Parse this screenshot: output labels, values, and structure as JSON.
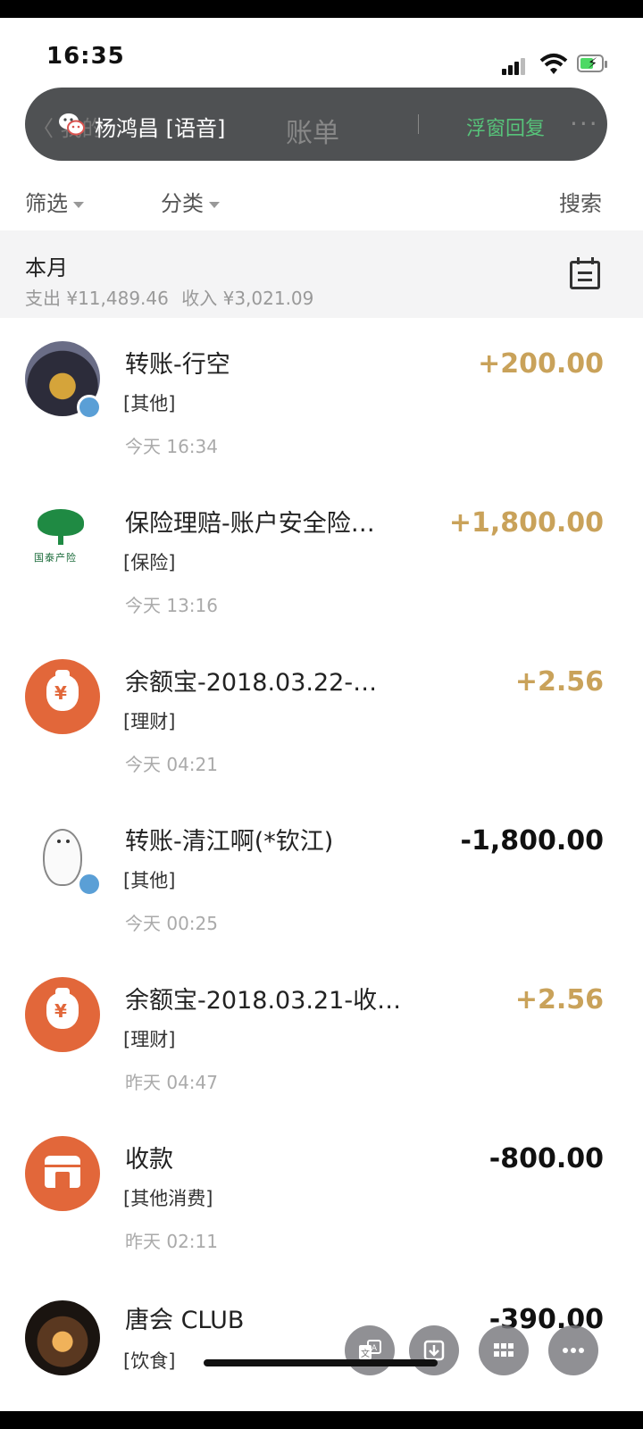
{
  "status_bar": {
    "time": "16:35",
    "icons": [
      "signal-icon",
      "wifi-icon",
      "battery-charging-icon"
    ]
  },
  "voice_call_pill": {
    "caller": "杨鸿昌 [语音]",
    "reply_label": "浮窗回复",
    "behind_title": "账单",
    "behind_back": "〈 我的",
    "behind_more": "···"
  },
  "filter_bar": {
    "filter_label": "筛选",
    "category_label": "分类",
    "search_label": "搜索"
  },
  "month": {
    "label": "本月",
    "expense_text": "支出 ¥11,489.46",
    "income_text": "收入 ¥3,021.09"
  },
  "bills": [
    {
      "title": "转账-行空",
      "category": "[其他]",
      "date": "今天 16:34",
      "amount": "+200.00",
      "type": "income",
      "avatar": "player-photo"
    },
    {
      "title": "保险理赔-账户安全险…",
      "category": "[保险]",
      "date": "今天 13:16",
      "amount": "+1,800.00",
      "type": "income",
      "avatar": "insurance-tree-logo",
      "logo_text": "国泰产险"
    },
    {
      "title": "余额宝-2018.03.22-…",
      "category": "[理财]",
      "date": "今天 04:21",
      "amount": "+2.56",
      "type": "income",
      "avatar": "money-bag-icon"
    },
    {
      "title": "转账-清江啊(*钦江)",
      "category": "[其他]",
      "date": "今天 00:25",
      "amount": "-1,800.00",
      "type": "expense",
      "avatar": "baymax-avatar"
    },
    {
      "title": "余额宝-2018.03.21-收…",
      "category": "[理财]",
      "date": "昨天 04:47",
      "amount": "+2.56",
      "type": "income",
      "avatar": "money-bag-icon"
    },
    {
      "title": "收款",
      "category": "[其他消费]",
      "date": "昨天 02:11",
      "amount": "-800.00",
      "type": "expense",
      "avatar": "shop-icon"
    },
    {
      "title": "唐会 CLUB",
      "category": "[饮食]",
      "date": "",
      "amount": "-390.00",
      "type": "expense",
      "avatar": "club-photo"
    }
  ],
  "colors": {
    "income": "#c9a25a",
    "expense": "#111111",
    "accent_orange": "#e2673a",
    "reply_green": "#57c37a"
  },
  "floating_buttons": [
    "translate-icon",
    "download-icon",
    "grid-icon",
    "more-icon"
  ]
}
